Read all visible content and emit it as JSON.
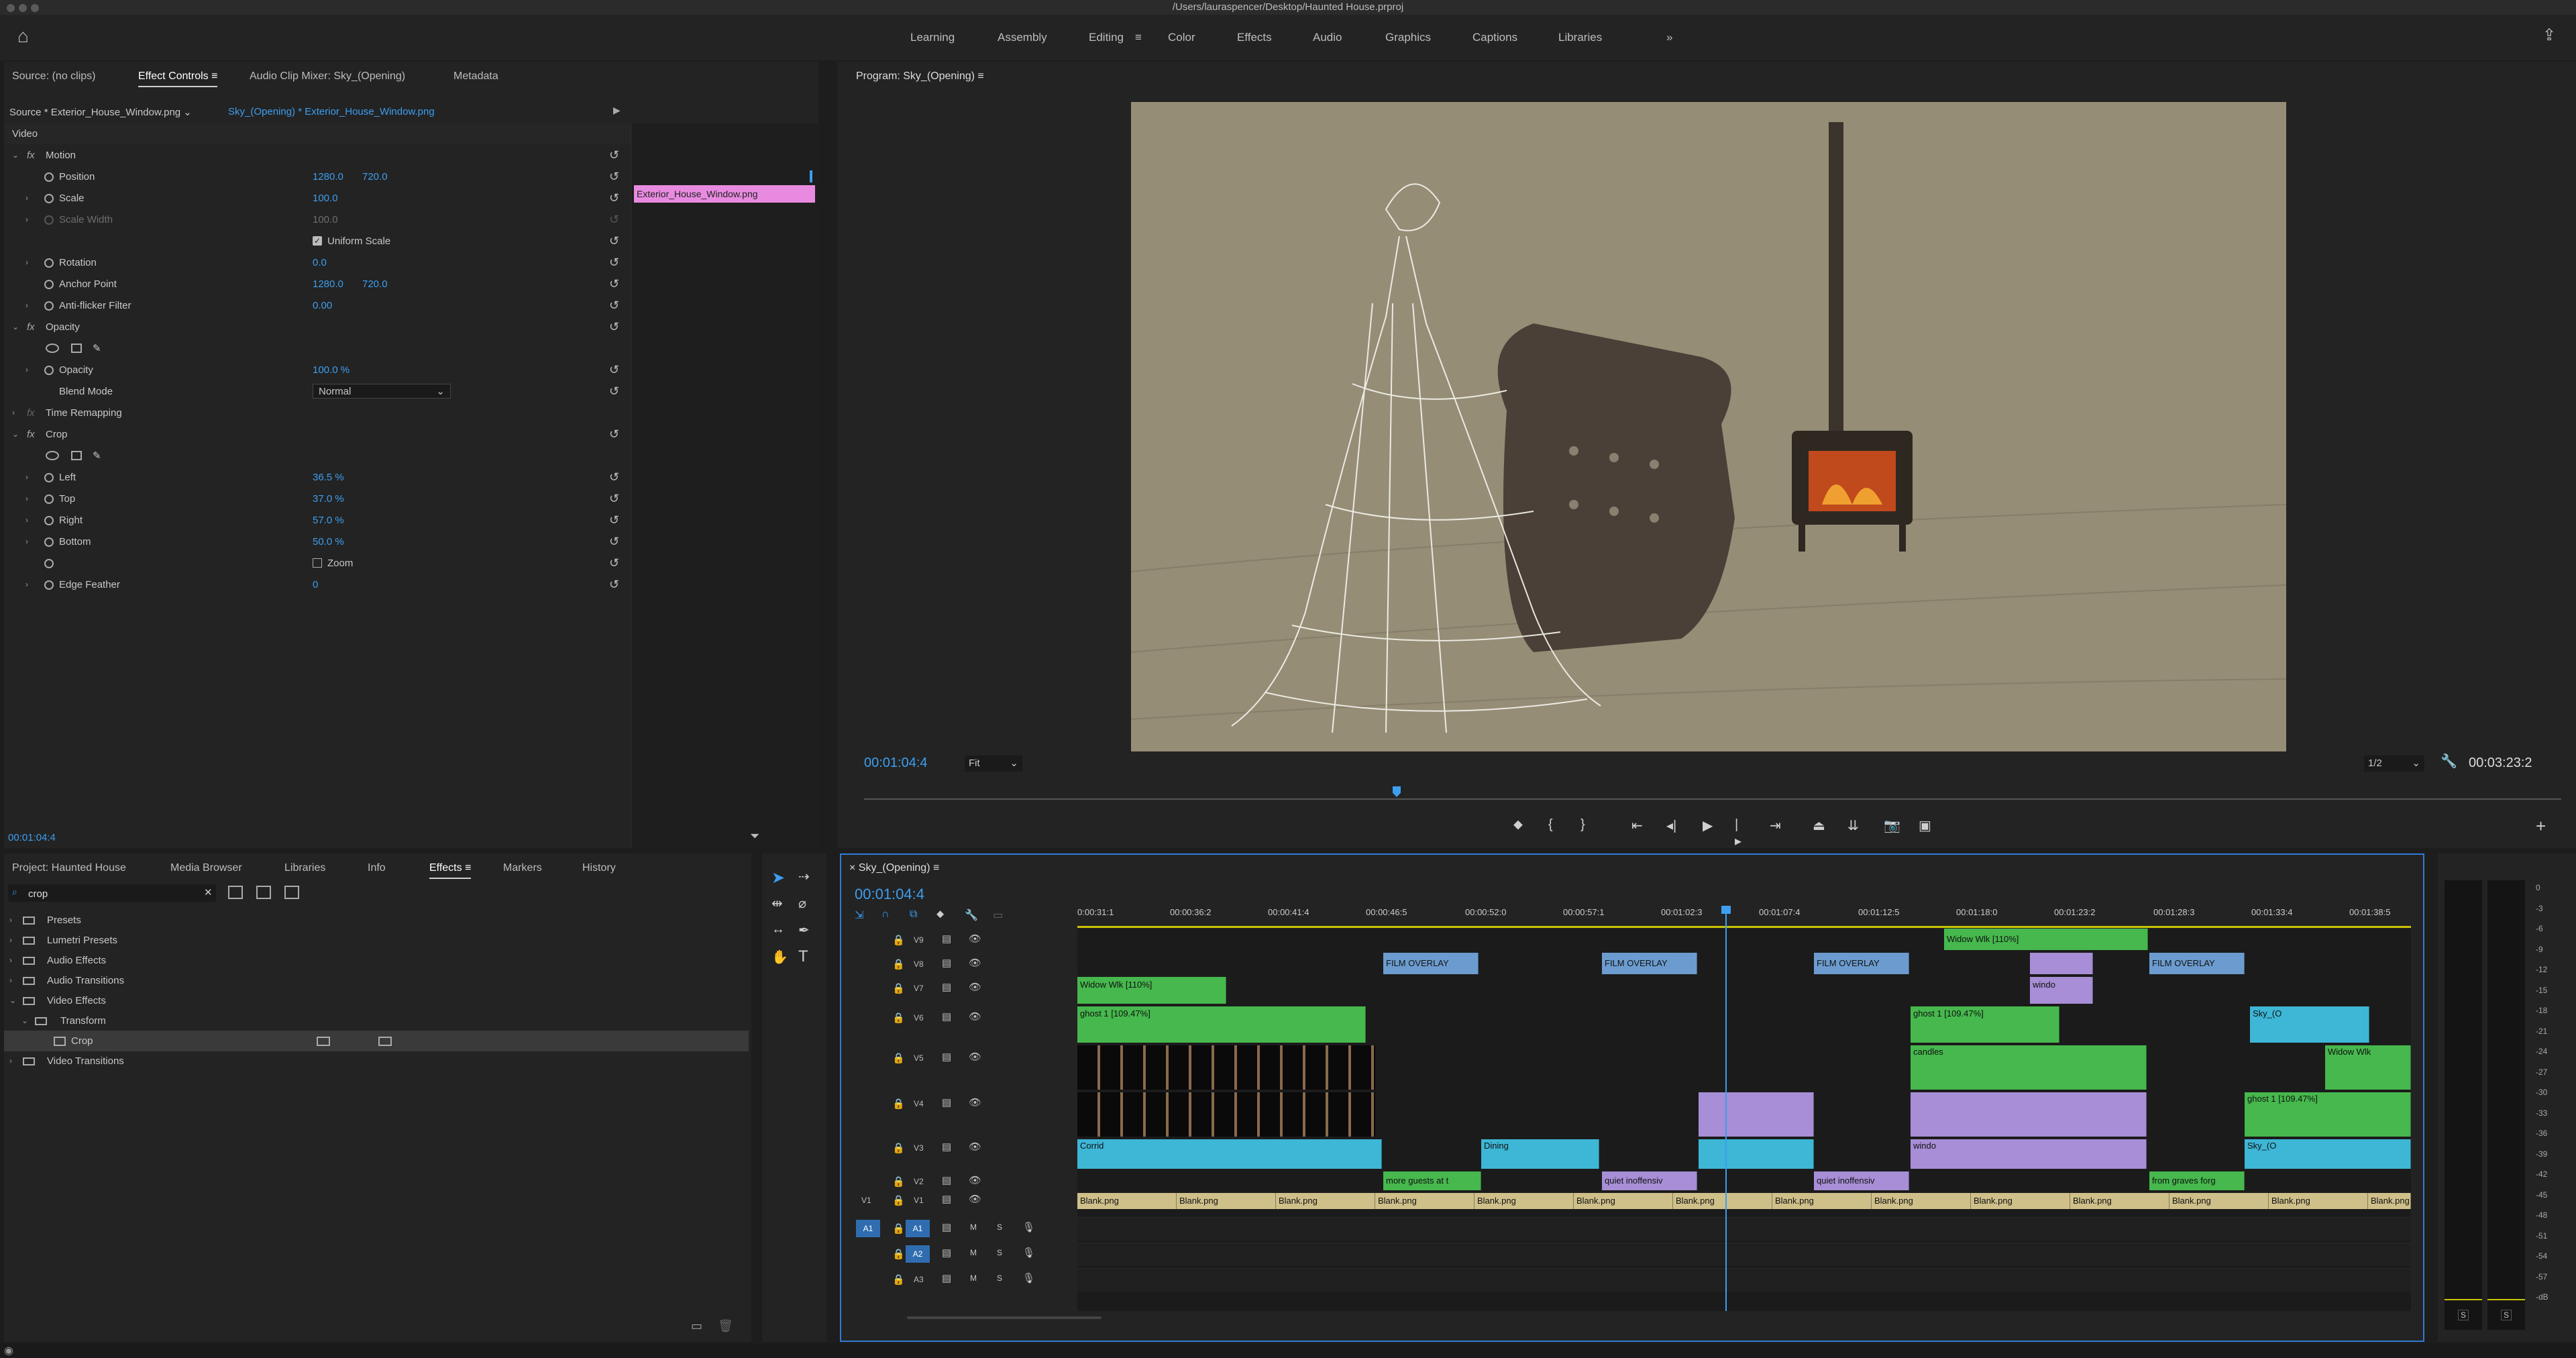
{
  "app": {
    "title": "/Users/lauraspencer/Desktop/Haunted House.prproj"
  },
  "workspaces": [
    "Learning",
    "Assembly",
    "Editing",
    "Color",
    "Effects",
    "Audio",
    "Graphics",
    "Captions",
    "Libraries"
  ],
  "workspace_active": "Editing",
  "top_panel": {
    "tabs": [
      "Source: (no clips)",
      "Effect Controls",
      "Audio Clip Mixer: Sky_(Opening)",
      "Metadata"
    ],
    "active_tab": "Effect Controls",
    "source_label": "Source * Exterior_House_Window.png",
    "sequence_label": "Sky_(Opening) * Exterior_House_Window.png",
    "clip_bar_label": "Exterior_House_Window.png",
    "video_header": "Video",
    "properties": {
      "motion": "Motion",
      "position_label": "Position",
      "position_x": "1280.0",
      "position_y": "720.0",
      "scale_label": "Scale",
      "scale_value": "100.0",
      "scale_width_label": "Scale Width",
      "scale_width_value": "100.0",
      "uniform_scale_label": "Uniform Scale",
      "rotation_label": "Rotation",
      "rotation_value": "0.0",
      "anchor_label": "Anchor Point",
      "anchor_x": "1280.0",
      "anchor_y": "720.0",
      "antiflicker_label": "Anti-flicker Filter",
      "antiflicker_value": "0.00",
      "opacity_header": "Opacity",
      "opacity_label": "Opacity",
      "opacity_value": "100.0 %",
      "blend_label": "Blend Mode",
      "blend_value": "Normal",
      "time_remap": "Time Remapping",
      "crop_header": "Crop",
      "left_label": "Left",
      "left_value": "36.5 %",
      "top_label": "Top",
      "top_value": "37.0 %",
      "right_label": "Right",
      "right_value": "57.0 %",
      "bottom_label": "Bottom",
      "bottom_value": "50.0 %",
      "zoom_label": "Zoom",
      "feather_label": "Edge Feather",
      "feather_value": "0"
    },
    "timecode": "00:01:04:4"
  },
  "program": {
    "title": "Program: Sky_(Opening)",
    "timecode": "00:01:04:4",
    "fit": "Fit",
    "resolution": "1/2",
    "duration": "00:03:23:2"
  },
  "project_panel": {
    "tabs": [
      "Project: Haunted House",
      "Media Browser",
      "Libraries",
      "Info",
      "Effects",
      "Markers",
      "History"
    ],
    "active_tab": "Effects",
    "search_value": "crop",
    "tree": [
      {
        "label": "Presets",
        "indent": 0
      },
      {
        "label": "Lumetri Presets",
        "indent": 0
      },
      {
        "label": "Audio Effects",
        "indent": 0
      },
      {
        "label": "Audio Transitions",
        "indent": 0
      },
      {
        "label": "Video Effects",
        "indent": 0
      },
      {
        "label": "Transform",
        "indent": 1
      },
      {
        "label": "Crop",
        "indent": 2
      },
      {
        "label": "Video Transitions",
        "indent": 0
      }
    ]
  },
  "timeline": {
    "title": "Sky_(Opening)",
    "timecode": "00:01:04:4",
    "ruler": [
      "0:00:31:1",
      "00:00:36:2",
      "00:00:41:4",
      "00:00:46:5",
      "00:00:52:0",
      "00:00:57:1",
      "00:01:02:3",
      "00:01:07:4",
      "00:01:12:5",
      "00:01:18:0",
      "00:01:23:2",
      "00:01:28:3",
      "00:01:33:4",
      "00:01:38:5"
    ],
    "video_tracks": [
      "V9",
      "V8",
      "V7",
      "V6",
      "V5",
      "V4",
      "V3",
      "V2",
      "V1"
    ],
    "audio_tracks": [
      "A1",
      "A2",
      "A3"
    ],
    "source_patch_v": "V1",
    "source_patch_a": "A1",
    "clip_labels": {
      "widow1": "Widow Wlk [110%]",
      "widow2": "Widow Wlk [110%]",
      "widow3": "Widow Wlk",
      "film1": "FILM OVERLAY",
      "film2": "FILM OVERLAY",
      "film3": "FILM OVERLAY",
      "film4": "FILM OVERLAY",
      "ghost1": "ghost 1 [109.47%]",
      "ghost2": "ghost 1 [109.47%]",
      "ghost3": "ghost 1 [109.47%]",
      "candles": "candles",
      "windo": "windo",
      "corrid": "Corrid",
      "dining": "Dining",
      "sky": "Sky_(O",
      "guests": "more guests at t",
      "quiet1": "quiet inoffensiv",
      "quiet2": "quiet inoffensiv",
      "graves": "from graves forg",
      "blank": "Blank.png"
    }
  },
  "meter_scale": [
    "0",
    "-3",
    "-6",
    "-9",
    "-12",
    "-15",
    "-18",
    "-21",
    "-24",
    "-27",
    "-30",
    "-33",
    "-36",
    "-39",
    "-42",
    "-45",
    "-48",
    "-51",
    "-54",
    "-57",
    "-dB"
  ],
  "meter_solo": [
    "S",
    "S"
  ],
  "colors": {
    "accent": "#3d9ef0",
    "clip_label": "#e88be0",
    "video_blue": "#3eb6d6",
    "green": "#46b84d",
    "purple": "#a78ed6",
    "tan": "#cfc08a"
  }
}
